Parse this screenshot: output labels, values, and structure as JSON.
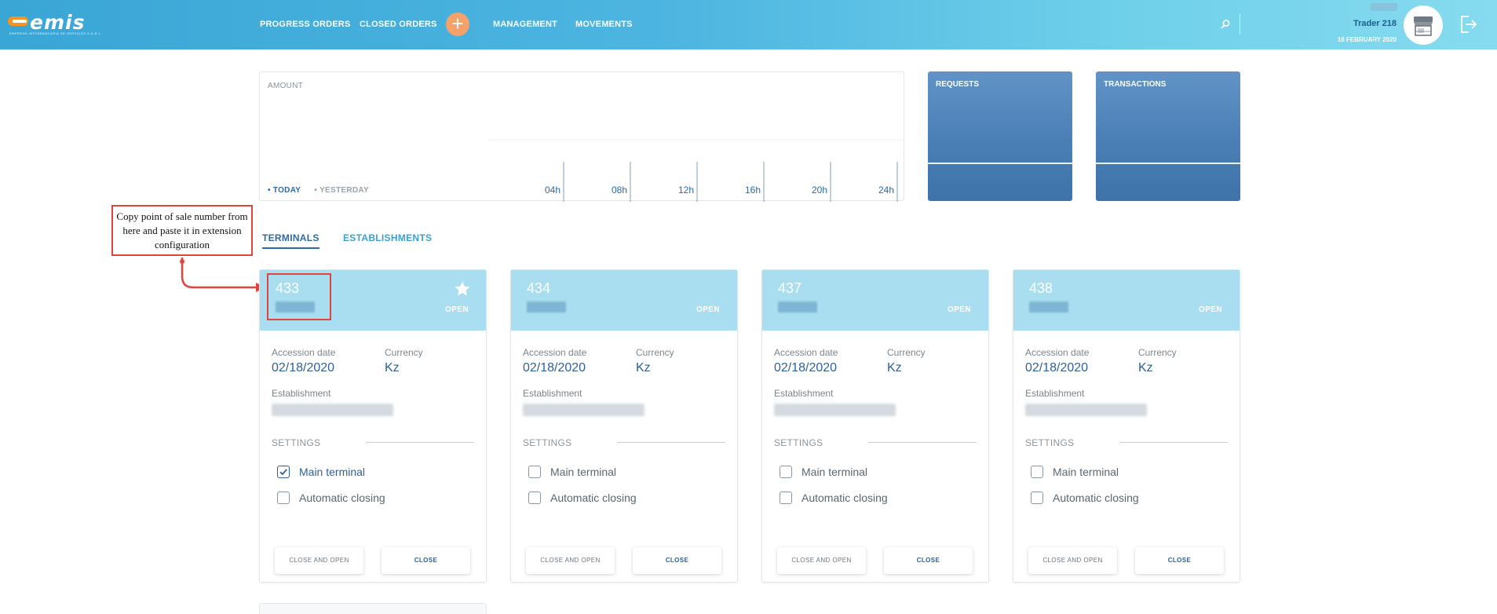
{
  "header": {
    "logo_text": "emis",
    "logo_tagline": "EMPRESA INTERBANCARIA DE SERVIÇOS S.A.R.L",
    "nav": [
      {
        "label": "PROGRESS ORDERS"
      },
      {
        "label": "CLOSED ORDERS"
      },
      {
        "label": "MANAGEMENT"
      },
      {
        "label": "MOVEMENTS"
      }
    ],
    "plus_symbol": "+",
    "user_name": "Trader 218",
    "date": "18 FEBRUARY 2020",
    "icons": {
      "search": "search-icon",
      "avatar": "store-avatar",
      "logout": "logout-icon"
    }
  },
  "amount_panel": {
    "label": "AMOUNT",
    "legend": [
      "• TODAY",
      "• YESTERDAY"
    ],
    "hours": [
      "04h",
      "08h",
      "12h",
      "16h",
      "20h",
      "24h"
    ]
  },
  "stat_cards": [
    {
      "label": "REQUESTS"
    },
    {
      "label": "TRANSACTIONS"
    }
  ],
  "tabs": [
    {
      "label": "TERMINALS",
      "active": true
    },
    {
      "label": "ESTABLISHMENTS",
      "active": false
    }
  ],
  "annotation": {
    "text": "Copy point of sale number from here and paste it in extension configuration"
  },
  "terminals": [
    {
      "number": "433",
      "status": "OPEN",
      "favorite": true,
      "accession_label": "Accession date",
      "accession_date": "02/18/2020",
      "currency_label": "Currency",
      "currency": "Kz",
      "establishment_label": "Establishment",
      "settings_label": "SETTINGS",
      "main_terminal_label": "Main terminal",
      "main_terminal": true,
      "auto_closing_label": "Automatic closing",
      "auto_closing": false,
      "btn_close_open": "CLOSE AND OPEN",
      "btn_close": "CLOSE"
    },
    {
      "number": "434",
      "status": "OPEN",
      "favorite": false,
      "accession_label": "Accession date",
      "accession_date": "02/18/2020",
      "currency_label": "Currency",
      "currency": "Kz",
      "establishment_label": "Establishment",
      "settings_label": "SETTINGS",
      "main_terminal_label": "Main terminal",
      "main_terminal": false,
      "auto_closing_label": "Automatic closing",
      "auto_closing": false,
      "btn_close_open": "CLOSE AND OPEN",
      "btn_close": "CLOSE"
    },
    {
      "number": "437",
      "status": "OPEN",
      "favorite": false,
      "accession_label": "Accession date",
      "accession_date": "02/18/2020",
      "currency_label": "Currency",
      "currency": "Kz",
      "establishment_label": "Establishment",
      "settings_label": "SETTINGS",
      "main_terminal_label": "Main terminal",
      "main_terminal": false,
      "auto_closing_label": "Automatic closing",
      "auto_closing": false,
      "btn_close_open": "CLOSE AND OPEN",
      "btn_close": "CLOSE"
    },
    {
      "number": "438",
      "status": "OPEN",
      "favorite": false,
      "accession_label": "Accession date",
      "accession_date": "02/18/2020",
      "currency_label": "Currency",
      "currency": "Kz",
      "establishment_label": "Establishment",
      "settings_label": "SETTINGS",
      "main_terminal_label": "Main terminal",
      "main_terminal": false,
      "auto_closing_label": "Automatic closing",
      "auto_closing": false,
      "btn_close_open": "CLOSE AND OPEN",
      "btn_close": "CLOSE"
    }
  ],
  "colors": {
    "header_start": "#3aa6d6",
    "header_end": "#86dbef",
    "accent": "#2f6aa3",
    "card_header": "#a9def0",
    "plus_button": "#f5a26a",
    "annotation": "#e0453d"
  }
}
